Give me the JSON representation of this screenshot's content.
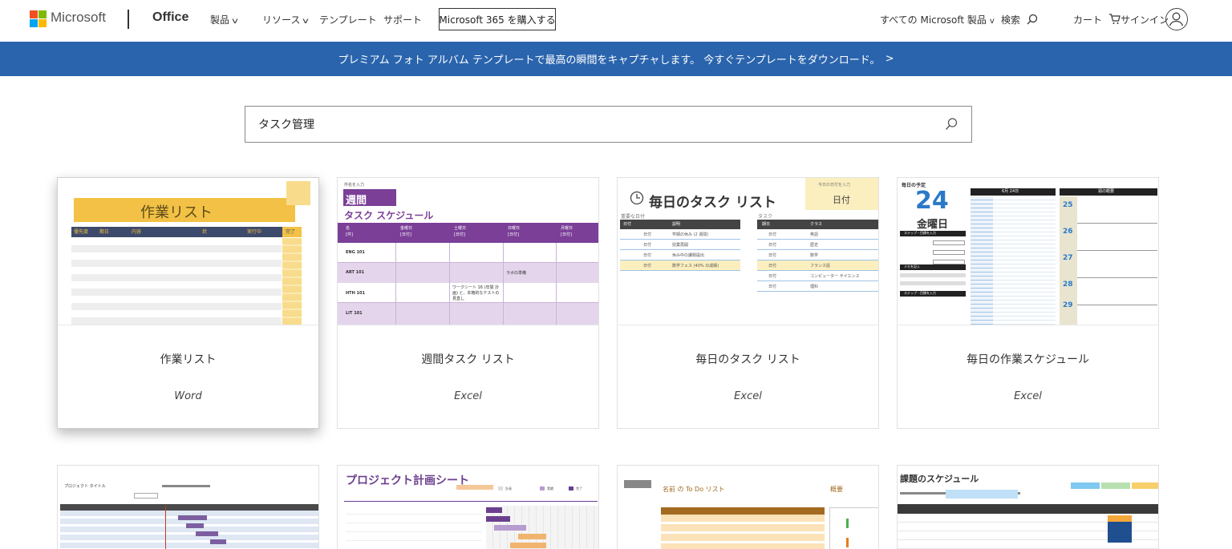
{
  "header": {
    "brand": "Microsoft",
    "product": "Office",
    "nav": [
      {
        "label": "製品"
      },
      {
        "label": "リソース"
      },
      {
        "label": "テンプレート"
      },
      {
        "label": "サポート"
      }
    ],
    "buy_button": "Microsoft 365 を購入する",
    "all_products": "すべての Microsoft 製品",
    "search_label": "検索",
    "cart_label": "カート",
    "signin_label": "サインイン",
    "logo_colors": [
      "#f25022",
      "#7fba00",
      "#00a4ef",
      "#ffb900"
    ]
  },
  "banner": {
    "text": "プレミアム フォト アルバム テンプレートで最高の瞬間をキャプチャします。 今すぐテンプレートをダウンロード。",
    "color": "#2a64ad"
  },
  "search": {
    "value": "タスク管理"
  },
  "cards": [
    {
      "title": "作業リスト",
      "app": "Word",
      "thumb": {
        "heading": "作業リスト",
        "columns": [
          "優先度",
          "期日",
          "内容",
          "",
          "状",
          "実行中",
          "完了"
        ]
      }
    },
    {
      "title": "週間タスク リスト",
      "app": "Excel",
      "thumb": {
        "kicker": "件名を入力",
        "heading1": "週間",
        "heading2": "タスク スケジュール",
        "col_first": "名",
        "col_first_sub": "[件]",
        "columns": [
          "金曜日",
          "土曜日",
          "日曜日",
          "月曜日"
        ],
        "col_sub": "[日付]",
        "rows": [
          "ENG 101",
          "ART 101",
          "HTH 101",
          "LIT 101"
        ],
        "cell_art": "ラボの準備",
        "cell_hth": "ワークシート 16 (年間 計画) と、本格的なテストの見直し"
      }
    },
    {
      "title": "毎日のタスク リスト",
      "app": "Excel",
      "thumb": {
        "heading": "毎日のタスク リスト",
        "note_label": "今日の日付を入力",
        "note_value": "日付",
        "left_caption": "重要な日付",
        "left_cols": [
          "日付",
          "説明"
        ],
        "left_rows": [
          "学期の休み (2 週間)",
          "授業再開",
          "休み中の課題提出",
          "数学フェス (40% の成績)"
        ],
        "right_caption": "タスク",
        "right_cols": [
          "期日",
          "クラス"
        ],
        "right_rows": [
          "英語",
          "歴史",
          "数学",
          "フランス語",
          "コンピューター サイエンス",
          "理科"
        ],
        "cell_date": "日付"
      }
    },
    {
      "title": "毎日の作業スケジュール",
      "app": "Excel",
      "thumb": {
        "kicker": "毎日の予定",
        "day": "24",
        "weekday": "金曜日",
        "date_header": "6月 24日",
        "week_header": "週の概要",
        "week_days": [
          "25",
          "26",
          "27",
          "28",
          "29"
        ],
        "section1": "ステップ・目標を入力",
        "section2": "メモを記入",
        "section3": "ステップ・目標を入力"
      }
    },
    {
      "thumb": {
        "heading": "プロジェクト タイトル"
      }
    },
    {
      "thumb": {
        "heading": "プロジェクト計画シート",
        "legend": [
          "計画",
          "実績",
          "完了"
        ]
      }
    },
    {
      "thumb": {
        "heading": "名前 の To Do リスト",
        "side": "概要"
      }
    },
    {
      "thumb": {
        "heading": "課題のスケジュール"
      }
    }
  ]
}
